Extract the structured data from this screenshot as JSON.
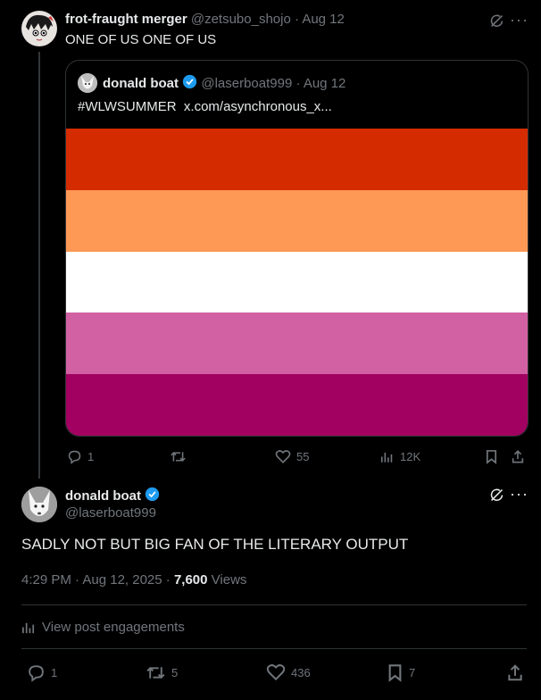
{
  "colors": {
    "verified": "#1d9bf0",
    "flag": [
      "#d42c00",
      "#fd9855",
      "#ffffff",
      "#d161a2",
      "#a20161"
    ]
  },
  "reply_tweet": {
    "author_name": "frot-fraught merger",
    "handle": "@zetsubo_shojo",
    "date": "· Aug 12",
    "text": "ONE OF US ONE OF US",
    "actions": {
      "replies": "1",
      "retweets": "",
      "likes": "55",
      "views": "12K"
    }
  },
  "quoted_tweet": {
    "author_name": "donald boat",
    "handle": "@laserboat999",
    "date": "· Aug 12",
    "hashtag": "#WLWSUMMER",
    "link": "x.com/asynchronous_x..."
  },
  "main_tweet": {
    "author_name": "donald boat",
    "handle": "@laserboat999",
    "text": "SADLY NOT BUT BIG FAN OF THE LITERARY OUTPUT",
    "time": "4:29 PM · Aug 12, 2025 · ",
    "views_count": "7,600",
    "views_label": " Views",
    "engagements_label": "View post engagements",
    "actions": {
      "replies": "1",
      "retweets": "5",
      "likes": "436",
      "bookmarks": "7"
    }
  }
}
